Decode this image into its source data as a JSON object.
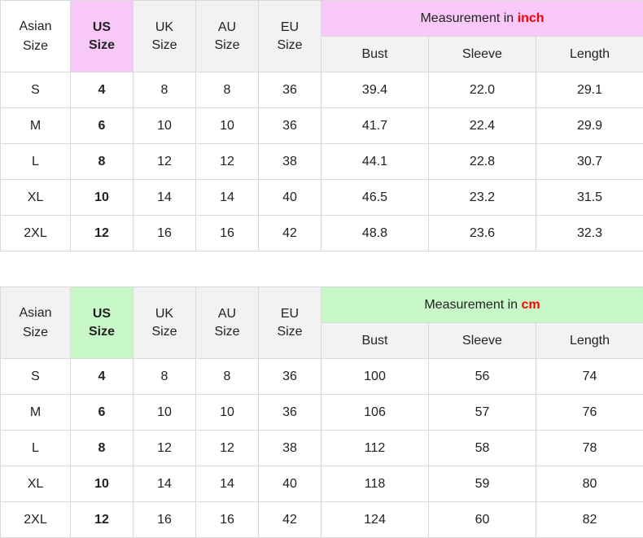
{
  "colors": {
    "inch_highlight": "#f8c8f8",
    "cm_highlight": "#c8f8c8",
    "unit_red": "#ff0000",
    "header_gray": "#f2f2f2"
  },
  "tables": [
    {
      "headers": {
        "asian": [
          "Asian",
          "Size"
        ],
        "us": [
          "US",
          "Size"
        ],
        "uk": [
          "UK",
          "Size"
        ],
        "au": [
          "AU",
          "Size"
        ],
        "eu": [
          "EU",
          "Size"
        ],
        "measurement_prefix": "Measurement in ",
        "unit": "inch",
        "bust": "Bust",
        "sleeve": "Sleeve",
        "length": "Length"
      },
      "rows": [
        {
          "asian": "S",
          "us": "4",
          "uk": "8",
          "au": "8",
          "eu": "36",
          "bust": "39.4",
          "sleeve": "22.0",
          "length": "29.1"
        },
        {
          "asian": "M",
          "us": "6",
          "uk": "10",
          "au": "10",
          "eu": "36",
          "bust": "41.7",
          "sleeve": "22.4",
          "length": "29.9"
        },
        {
          "asian": "L",
          "us": "8",
          "uk": "12",
          "au": "12",
          "eu": "38",
          "bust": "44.1",
          "sleeve": "22.8",
          "length": "30.7"
        },
        {
          "asian": "XL",
          "us": "10",
          "uk": "14",
          "au": "14",
          "eu": "40",
          "bust": "46.5",
          "sleeve": "23.2",
          "length": "31.5"
        },
        {
          "asian": "2XL",
          "us": "12",
          "uk": "16",
          "au": "16",
          "eu": "42",
          "bust": "48.8",
          "sleeve": "23.6",
          "length": "32.3"
        }
      ]
    },
    {
      "headers": {
        "asian": [
          "Asian",
          "Size"
        ],
        "us": [
          "US",
          "Size"
        ],
        "uk": [
          "UK",
          "Size"
        ],
        "au": [
          "AU",
          "Size"
        ],
        "eu": [
          "EU",
          "Size"
        ],
        "measurement_prefix": "Measurement in ",
        "unit": "cm",
        "bust": "Bust",
        "sleeve": "Sleeve",
        "length": "Length"
      },
      "rows": [
        {
          "asian": "S",
          "us": "4",
          "uk": "8",
          "au": "8",
          "eu": "36",
          "bust": "100",
          "sleeve": "56",
          "length": "74"
        },
        {
          "asian": "M",
          "us": "6",
          "uk": "10",
          "au": "10",
          "eu": "36",
          "bust": "106",
          "sleeve": "57",
          "length": "76"
        },
        {
          "asian": "L",
          "us": "8",
          "uk": "12",
          "au": "12",
          "eu": "38",
          "bust": "112",
          "sleeve": "58",
          "length": "78"
        },
        {
          "asian": "XL",
          "us": "10",
          "uk": "14",
          "au": "14",
          "eu": "40",
          "bust": "118",
          "sleeve": "59",
          "length": "80"
        },
        {
          "asian": "2XL",
          "us": "12",
          "uk": "16",
          "au": "16",
          "eu": "42",
          "bust": "124",
          "sleeve": "60",
          "length": "82"
        }
      ]
    }
  ]
}
